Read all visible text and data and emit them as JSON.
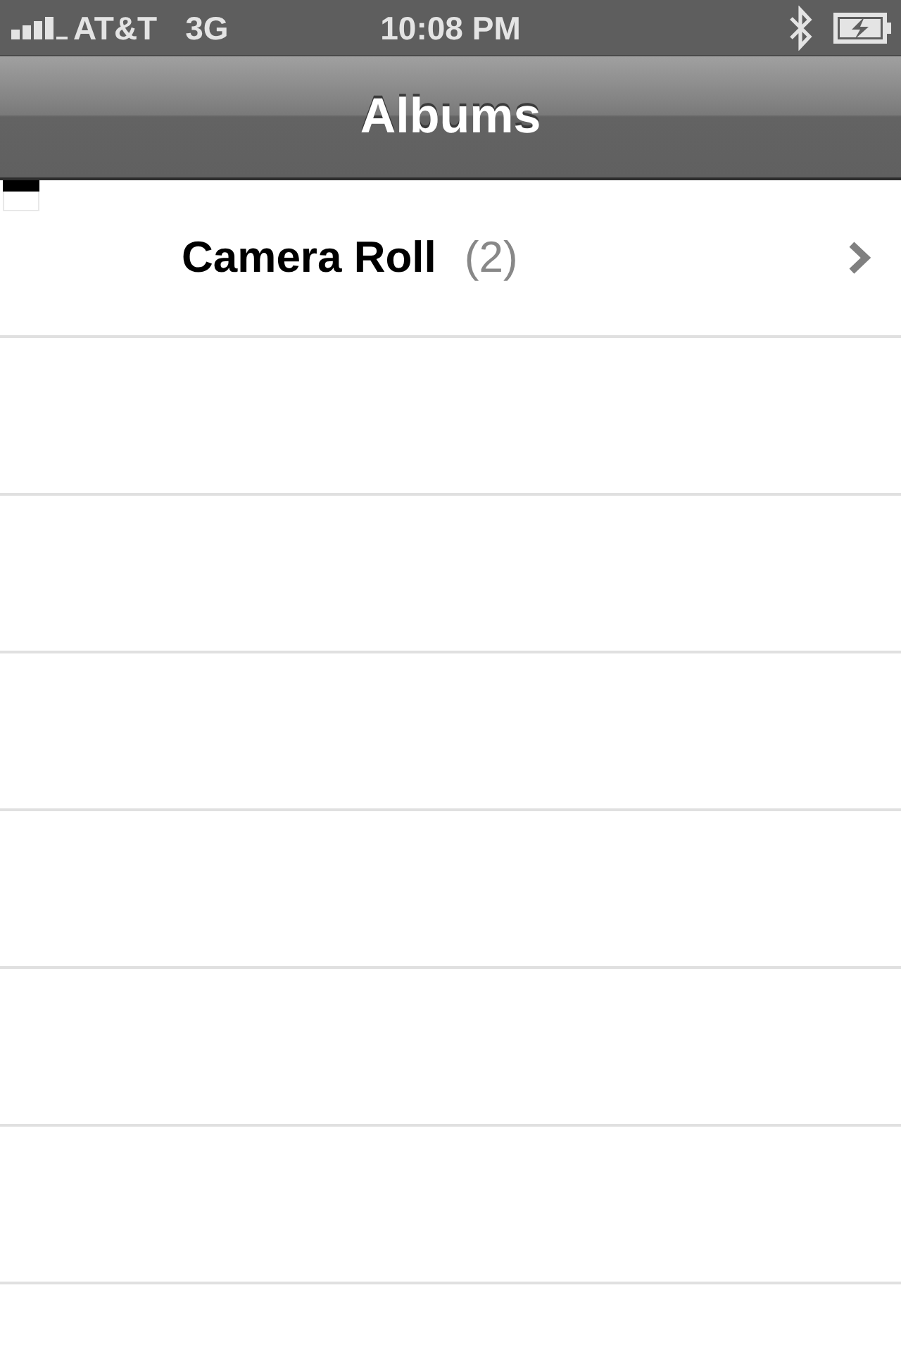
{
  "status_bar": {
    "carrier": "AT&T",
    "network": "3G",
    "time": "10:08 PM"
  },
  "nav_bar": {
    "title": "Albums"
  },
  "albums": [
    {
      "name": "Camera Roll",
      "count": "(2)"
    }
  ]
}
